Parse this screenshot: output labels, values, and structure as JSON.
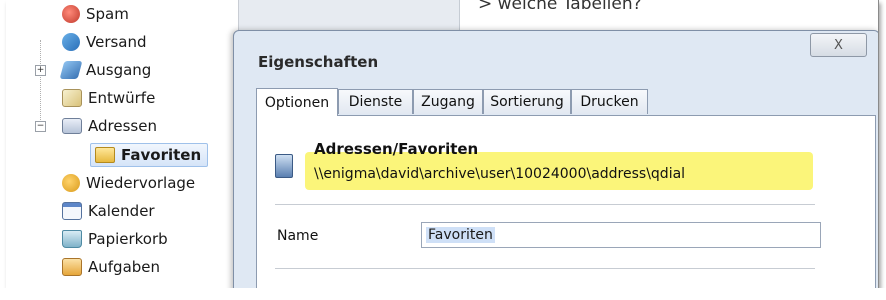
{
  "tree": {
    "items": [
      {
        "label": "Spam",
        "icon": "spam-icon"
      },
      {
        "label": "Versand",
        "icon": "send-icon"
      },
      {
        "label": "Ausgang",
        "icon": "outbox-icon",
        "expander": "+"
      },
      {
        "label": "Entwürfe",
        "icon": "drafts-icon"
      },
      {
        "label": "Adressen",
        "icon": "address-book-icon",
        "expander": "−"
      },
      {
        "label": "Favoriten",
        "icon": "folder-icon",
        "selected": true
      },
      {
        "label": "Wiedervorlage",
        "icon": "followup-icon"
      },
      {
        "label": "Kalender",
        "icon": "calendar-icon"
      },
      {
        "label": "Papierkorb",
        "icon": "trash-icon"
      },
      {
        "label": "Aufgaben",
        "icon": "tasks-icon"
      }
    ]
  },
  "background": {
    "partial_text": "> welche Tabellen?"
  },
  "dialog": {
    "title": "Eigenschaften",
    "close_label": "X",
    "tabs": [
      {
        "label": "Optionen",
        "active": true
      },
      {
        "label": "Dienste"
      },
      {
        "label": "Zugang"
      },
      {
        "label": "Sortierung"
      },
      {
        "label": "Drucken"
      }
    ],
    "path_title": "Adressen/Favoriten",
    "path": "\\\\enigma\\david\\archive\\user\\10024000\\address\\qdial",
    "name_label": "Name",
    "name_value": "Favoriten"
  },
  "colors": {
    "highlight": "#fbf57a",
    "selection": "#d5e4f8",
    "dialog_bg": "#dfe8f3"
  }
}
